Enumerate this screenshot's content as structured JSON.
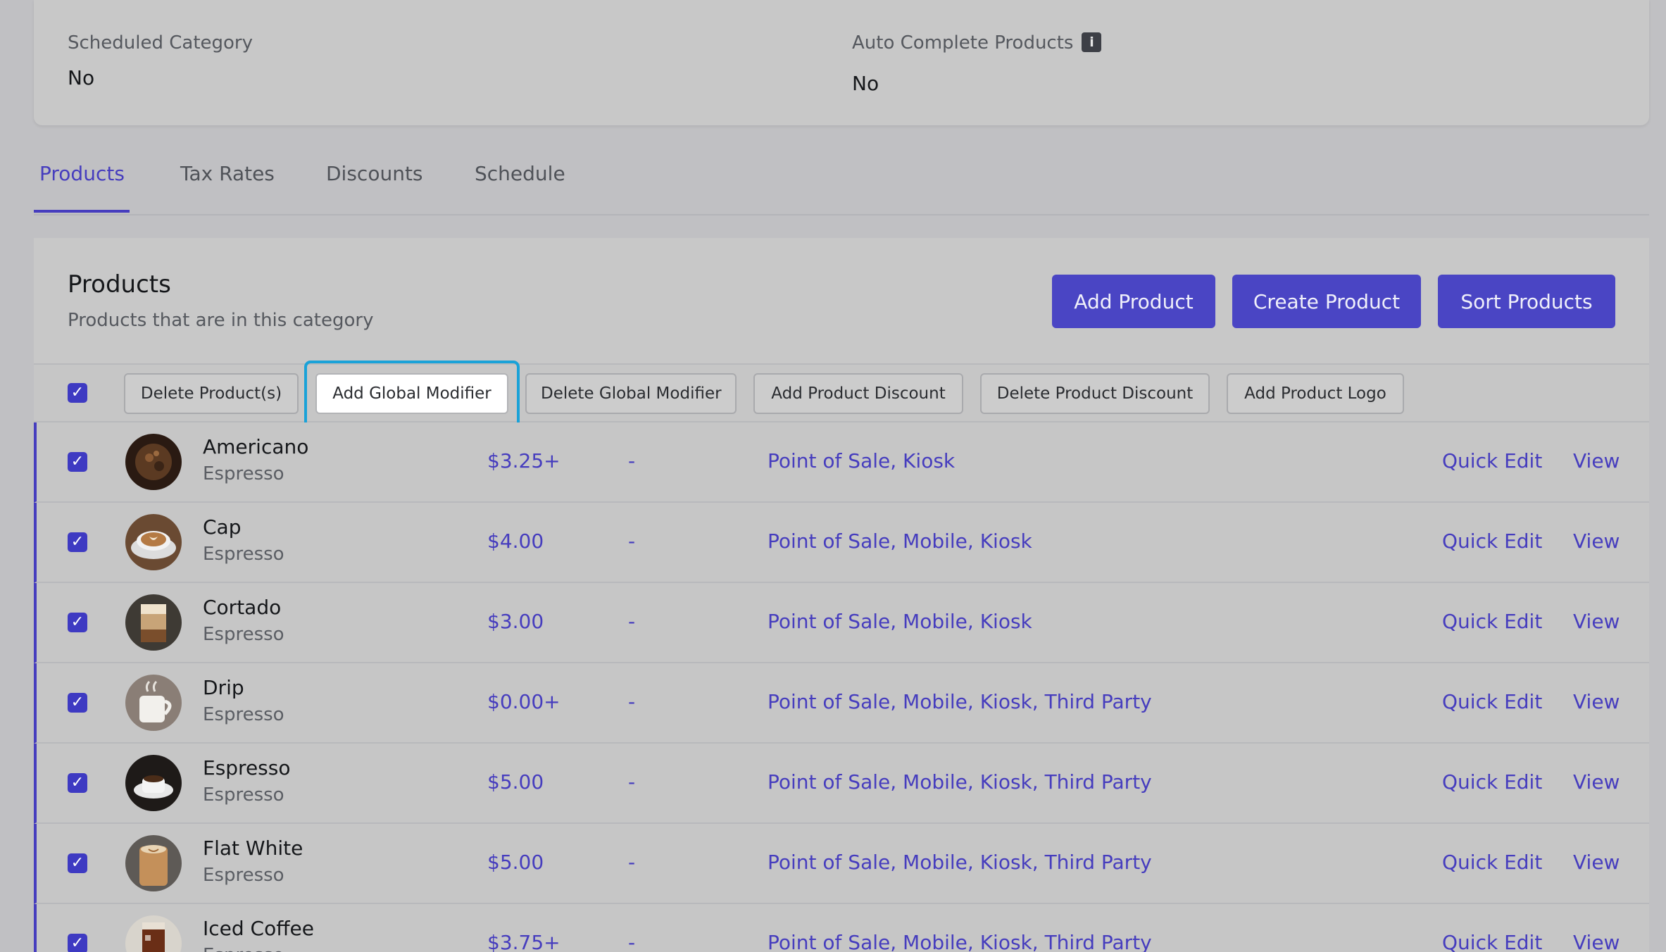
{
  "details": {
    "scheduled_category_label": "Scheduled Category",
    "scheduled_category_value": "No",
    "auto_complete_label": "Auto Complete Products",
    "auto_complete_info": "i",
    "auto_complete_value": "No"
  },
  "tabs": [
    {
      "label": "Products",
      "active": true
    },
    {
      "label": "Tax Rates",
      "active": false
    },
    {
      "label": "Discounts",
      "active": false
    },
    {
      "label": "Schedule",
      "active": false
    }
  ],
  "products_section": {
    "title": "Products",
    "subtitle": "Products that are in this category",
    "add_product_label": "Add Product",
    "create_product_label": "Create Product",
    "sort_products_label": "Sort Products"
  },
  "bulk_actions": {
    "delete_products": "Delete Product(s)",
    "add_global_modifier": "Add Global Modifier",
    "delete_global_modifier": "Delete Global Modifier",
    "add_product_discount": "Add Product Discount",
    "delete_product_discount": "Delete Product Discount",
    "add_product_logo": "Add Product Logo"
  },
  "check_glyph": "✓",
  "rows": [
    {
      "name": "Americano",
      "category": "Espresso",
      "price": "$3.25+",
      "discount": "-",
      "channels": "Point of Sale, Kiosk",
      "quick_edit": "Quick Edit",
      "view": "View"
    },
    {
      "name": "Cap",
      "category": "Espresso",
      "price": "$4.00",
      "discount": "-",
      "channels": "Point of Sale, Mobile, Kiosk",
      "quick_edit": "Quick Edit",
      "view": "View"
    },
    {
      "name": "Cortado",
      "category": "Espresso",
      "price": "$3.00",
      "discount": "-",
      "channels": "Point of Sale, Mobile, Kiosk",
      "quick_edit": "Quick Edit",
      "view": "View"
    },
    {
      "name": "Drip",
      "category": "Espresso",
      "price": "$0.00+",
      "discount": "-",
      "channels": "Point of Sale, Mobile, Kiosk, Third Party",
      "quick_edit": "Quick Edit",
      "view": "View"
    },
    {
      "name": "Espresso",
      "category": "Espresso",
      "price": "$5.00",
      "discount": "-",
      "channels": "Point of Sale, Mobile, Kiosk, Third Party",
      "quick_edit": "Quick Edit",
      "view": "View"
    },
    {
      "name": "Flat White",
      "category": "Espresso",
      "price": "$5.00",
      "discount": "-",
      "channels": "Point of Sale, Mobile, Kiosk, Third Party",
      "quick_edit": "Quick Edit",
      "view": "View"
    },
    {
      "name": "Iced Coffee",
      "category": "Espresso",
      "price": "$3.75+",
      "discount": "-",
      "channels": "Point of Sale, Mobile, Kiosk, Third Party",
      "quick_edit": "Quick Edit",
      "view": "View"
    }
  ],
  "colors": {
    "accent": "#463dbe",
    "primary_button": "#4a45c4",
    "focus_ring": "#1aa2d8",
    "background": "#c0c0c3"
  }
}
